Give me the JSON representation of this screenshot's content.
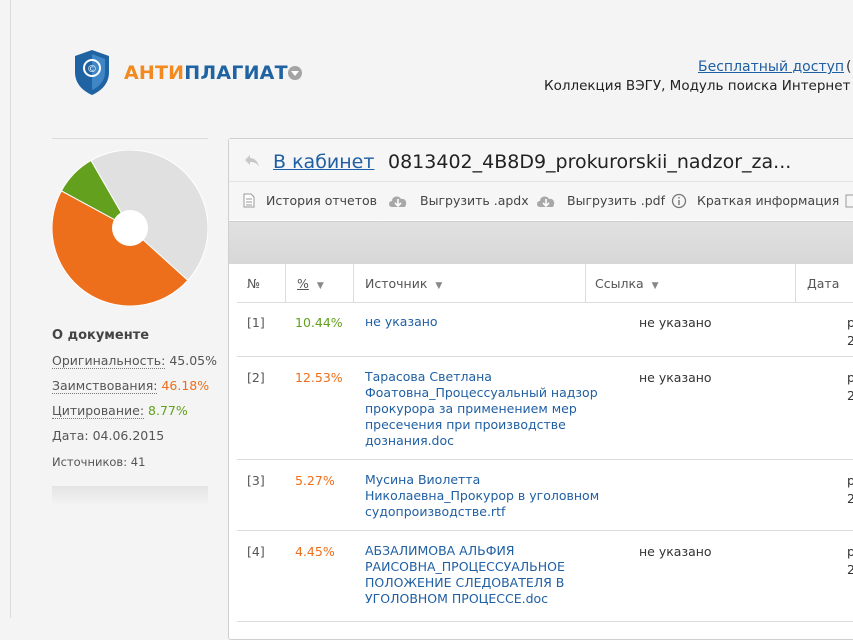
{
  "header": {
    "logo": {
      "part1": "АНТИ",
      "part2": "ПЛАГИАТ"
    },
    "free_access": "Бесплатный доступ",
    "free_access_paren": "(",
    "collection": "Коллекция ВЭГУ, Модуль поиска Интернет"
  },
  "colors": {
    "accent_orange": "#ee6f1b",
    "accent_green": "#62a01e",
    "link_blue": "#1f5fa3",
    "pie_grey": "#e0e0e0"
  },
  "about": {
    "title": "О документе",
    "originality_label": "Оригинальность:",
    "originality_value": "45.05%",
    "borrow_label": "Заимствования:",
    "borrow_value": "46.18%",
    "cite_label": "Цитирование:",
    "cite_value": "8.77%",
    "date_label": "Дата:",
    "date_value": "04.06.2015",
    "sources_label": "Источников:",
    "sources_value": "41"
  },
  "pie": {
    "originality": 45.05,
    "borrowing": 46.18,
    "citation": 8.77
  },
  "card": {
    "cabinet_link": "В кабинет",
    "doc_name": "0813402_4B8D9_prokurorskii_nadzor_za..."
  },
  "toolbar": {
    "history": "История отчетов",
    "export_apdx": "Выгрузить .apdx",
    "export_pdf": "Выгрузить .pdf",
    "brief_info": "Краткая информация"
  },
  "table": {
    "headers": {
      "num": "№",
      "pct": "%",
      "source": "Источник",
      "link": "Ссылка",
      "date": "Дата"
    },
    "rows": [
      {
        "num": "[1]",
        "pct": "10.44%",
        "source": "не указано",
        "link": "не указано",
        "date1": "р",
        "date2": "2"
      },
      {
        "num": "[2]",
        "pct": "12.53%",
        "source": "Тарасова Светлана Фоатовна_Процессуальный надзор прокурора за применением мер пресечения при производстве дознания.doc",
        "link": "не указано",
        "date1": "р",
        "date2": "2"
      },
      {
        "num": "[3]",
        "pct": "5.27%",
        "source": "Мусина Виолетта Николаевна_Прокурор в уголовном судопроизводстве.rtf",
        "link": "",
        "date1": "р",
        "date2": "2"
      },
      {
        "num": "[4]",
        "pct": "4.45%",
        "source": "АБЗАЛИМОВА АЛЬФИЯ РАИСОВНА_ПРОЦЕССУАЛЬНОЕ ПОЛОЖЕНИЕ СЛЕДОВАТЕЛЯ В УГОЛОВНОМ ПРОЦЕССЕ.doc",
        "link": "не указано",
        "date1": "р",
        "date2": "2"
      }
    ]
  }
}
